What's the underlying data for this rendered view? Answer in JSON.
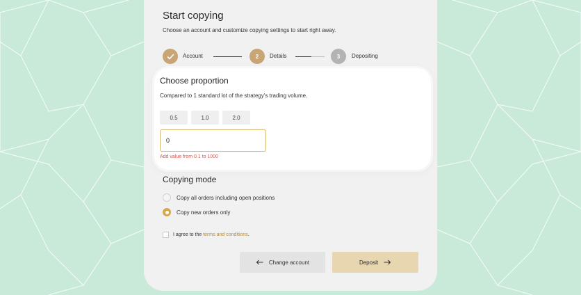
{
  "header": {
    "title": "Start copying",
    "subtitle": "Choose an account and customize copying settings to start right away."
  },
  "steps": [
    {
      "number": "",
      "label": "Account",
      "state": "done"
    },
    {
      "number": "2",
      "label": "Details",
      "state": "active"
    },
    {
      "number": "3",
      "label": "Depositing",
      "state": "pending"
    }
  ],
  "proportion": {
    "title": "Choose proportion",
    "description": "Compared to 1 standard lot of the strategy's trading volume.",
    "options": [
      "0.5",
      "1.0",
      "2.0"
    ],
    "input_value": "0",
    "error": "Add value from 0.1 to 1000"
  },
  "copying_mode": {
    "title": "Copying mode",
    "options": [
      {
        "label": "Copy all orders including open positions",
        "selected": false
      },
      {
        "label": "Copy new orders only",
        "selected": true
      }
    ]
  },
  "agreement": {
    "prefix": "I agree to the ",
    "link": "terms and conditions",
    "suffix": ".",
    "checked": false
  },
  "buttons": {
    "back_label": "Change account",
    "next_label": "Deposit"
  },
  "colors": {
    "background": "#c9ead9",
    "accent": "#c8a574",
    "radio_accent": "#d8a84c",
    "error": "#d4534a",
    "link": "#b58a3c"
  }
}
